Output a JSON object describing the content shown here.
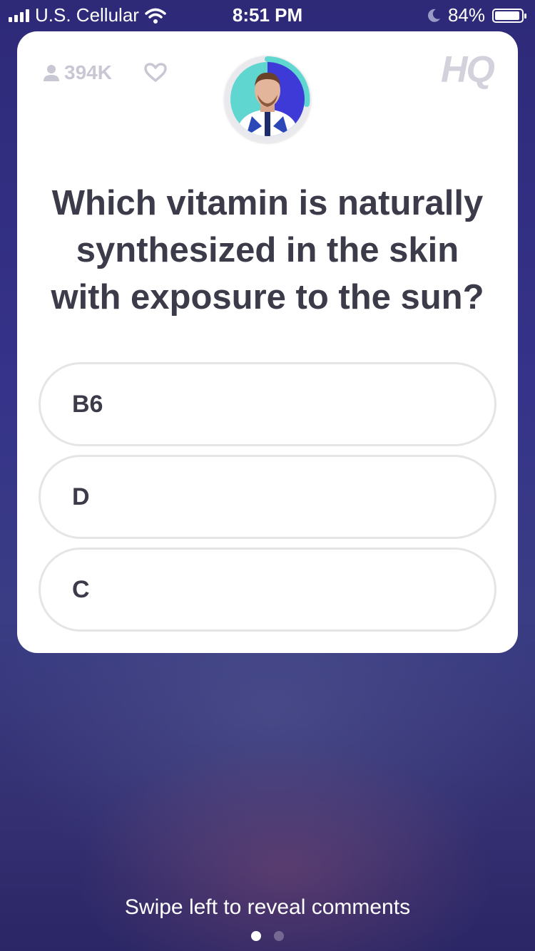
{
  "status_bar": {
    "carrier": "U.S. Cellular",
    "time": "8:51 PM",
    "battery": "84%",
    "signal_icon": "signal-bars-icon",
    "wifi_icon": "wifi-icon",
    "moon_icon": "do-not-disturb-icon",
    "battery_icon": "battery-icon"
  },
  "card": {
    "viewer_count": "394K",
    "viewer_icon": "person-icon",
    "heart_icon": "heart-icon",
    "logo": "HQ",
    "host_icon": "host-avatar",
    "timer_color": "#5fd6d0"
  },
  "question": {
    "text": "Which vitamin is naturally synthesized in the skin with exposure to the sun?"
  },
  "answers": [
    {
      "label": "B6"
    },
    {
      "label": "D"
    },
    {
      "label": "C"
    }
  ],
  "footer": {
    "hint": "Swipe left to reveal comments",
    "pages": 2,
    "active_page": 1
  },
  "colors": {
    "background": "#32307f",
    "card": "#ffffff",
    "text": "#3b3b4a",
    "muted": "#c8c7d4",
    "answer_border": "#e5e5e8"
  }
}
